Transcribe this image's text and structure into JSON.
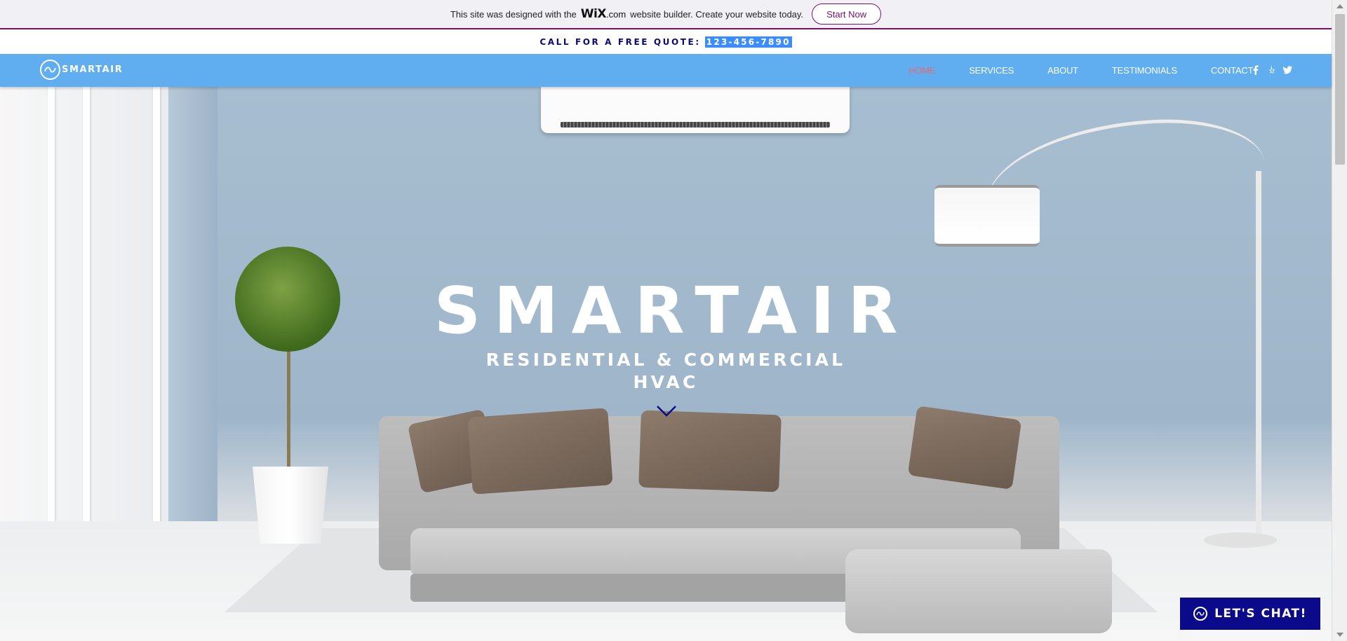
{
  "wix_banner": {
    "text_before": "This site was designed with the",
    "brand": "WiX",
    "brand_suffix": ".com",
    "text_after": "website builder. Create your website today.",
    "cta_label": "Start Now"
  },
  "quote_bar": {
    "label": "CALL FOR A FREE QUOTE:",
    "phone": "123-456-7890"
  },
  "nav": {
    "logo_text": "SMARTAIR",
    "items": [
      {
        "label": "HOME",
        "active": true
      },
      {
        "label": "SERVICES",
        "active": false
      },
      {
        "label": "ABOUT",
        "active": false
      },
      {
        "label": "TESTIMONIALS",
        "active": false
      },
      {
        "label": "CONTACT",
        "active": false
      }
    ],
    "socials": [
      {
        "icon": "facebook-icon",
        "glyph": "f"
      },
      {
        "icon": "yelp-icon",
        "glyph": "✱"
      },
      {
        "icon": "twitter-icon",
        "glyph": "🐦"
      }
    ]
  },
  "hero": {
    "title": "SMARTAIR",
    "subtitle_line1": "RESIDENTIAL & COMMERCIAL",
    "subtitle_line2": "HVAC"
  },
  "chat": {
    "label": "LET'S CHAT!"
  },
  "colors": {
    "nav_bg": "#60aef0",
    "active_nav": "#e86a6a",
    "brand_dark_blue": "#0a0a8a",
    "wix_accent": "#7a0f6e"
  }
}
